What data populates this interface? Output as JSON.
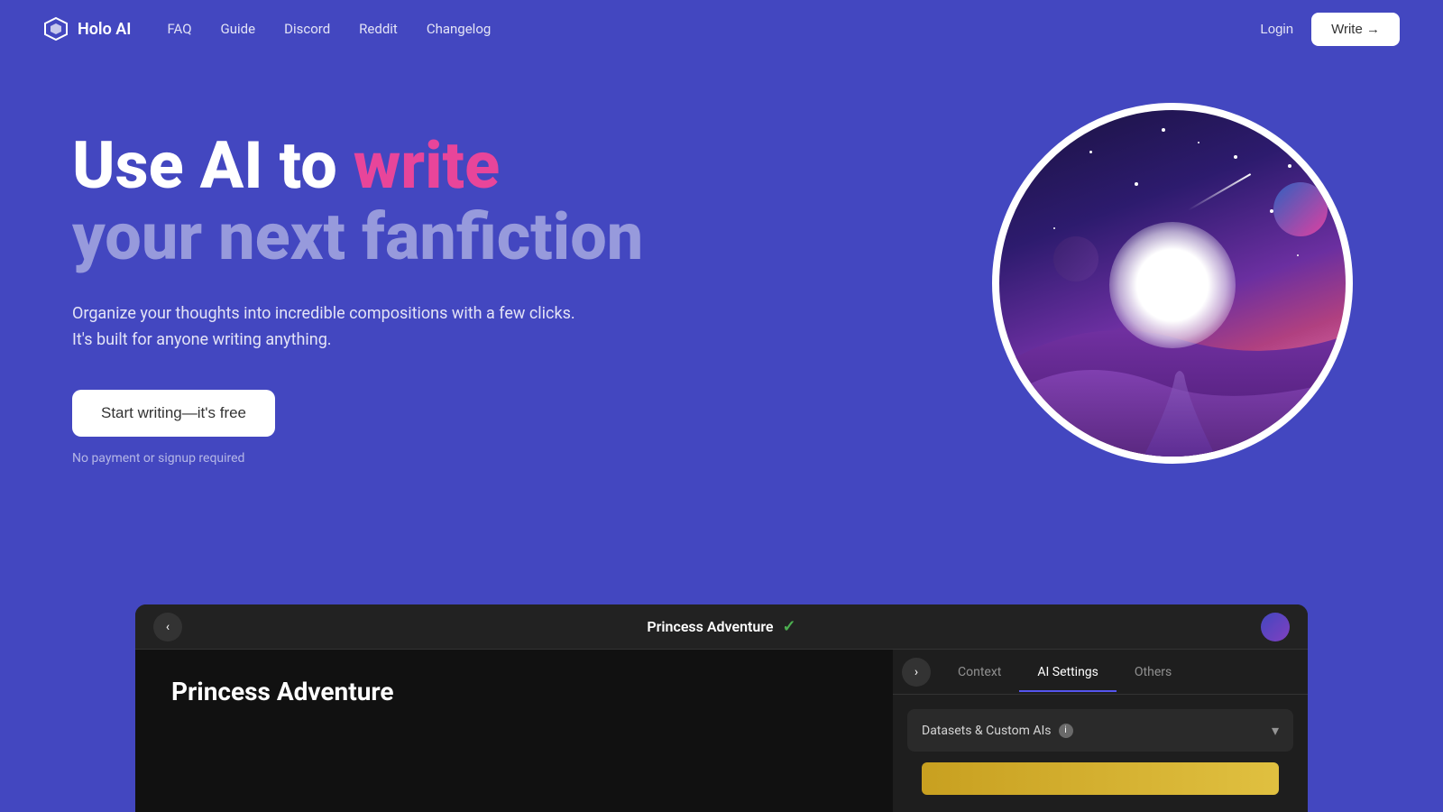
{
  "page": {
    "bg_color": "#4347c0"
  },
  "header": {
    "logo_text": "Holo AI",
    "nav_items": [
      "FAQ",
      "Guide",
      "Discord",
      "Reddit",
      "Changelog"
    ],
    "login_label": "Login",
    "write_label": "Write →"
  },
  "hero": {
    "title_part1": "Use AI to ",
    "title_highlight": "write",
    "title_part2": "your next fanfiction",
    "description_line1": "Organize your thoughts into incredible compositions with a few clicks.",
    "description_line2": "It's built for anyone writing anything.",
    "cta_label": "Start writing—it's free",
    "no_payment": "No payment or signup required"
  },
  "app_preview": {
    "project_title": "Princess Adventure",
    "check_symbol": "✓",
    "back_arrow": "‹",
    "story_title": "Princess Adventure",
    "tabs": {
      "arrow": "›",
      "items": [
        {
          "label": "Context",
          "active": false
        },
        {
          "label": "AI Settings",
          "active": true
        },
        {
          "label": "Others",
          "active": false
        }
      ]
    },
    "dataset_label": "Datasets & Custom AIs",
    "info_icon": "i",
    "chevron": "▾"
  }
}
